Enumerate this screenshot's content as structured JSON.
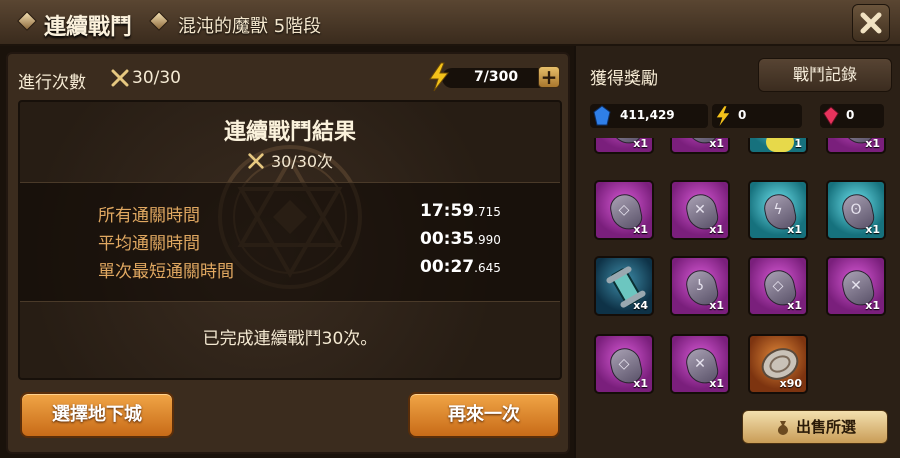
{
  "header": {
    "title": "連續戰鬥",
    "subtitle": "混沌的魔獸 5階段",
    "close_icon": "close-x-icon"
  },
  "left_panel": {
    "run_label": "進行次數",
    "run_count": "30/30",
    "energy": "7/300",
    "energy_plus": "+",
    "result_title": "連續戰鬥結果",
    "result_count": "30/30次",
    "stats": [
      {
        "label": "所有通關時間",
        "value_main": "17:59",
        "value_ms": ".715"
      },
      {
        "label": "平均通關時間",
        "value_main": "00:35",
        "value_ms": ".990"
      },
      {
        "label": "單次最短通關時間",
        "value_main": "00:27",
        "value_ms": ".645"
      }
    ],
    "done_text": "已完成連續戰鬥30次。",
    "btn_select_dungeon": "選擇地下城",
    "btn_retry": "再來一次"
  },
  "right_panel": {
    "rewards_label": "獲得獎勵",
    "log_button": "戰鬥記錄",
    "currencies": [
      {
        "icon": "blue-crystal-icon",
        "value": "411,429",
        "color": "#2f7fe8"
      },
      {
        "icon": "lightning-energy-icon",
        "value": "0",
        "color": "#f4c21a"
      },
      {
        "icon": "red-crystal-icon",
        "value": "0",
        "color": "#e8335c"
      }
    ],
    "items": [
      {
        "type": "purple",
        "glyph": "",
        "qty": "x1"
      },
      {
        "type": "purple",
        "glyph": "",
        "qty": "x1"
      },
      {
        "type": "cyan",
        "glyph": "",
        "qty": "1"
      },
      {
        "type": "purple",
        "glyph": "",
        "qty": "x1"
      },
      {
        "type": "purple",
        "glyph": "◇",
        "qty": "x1"
      },
      {
        "type": "purple",
        "glyph": "✕",
        "qty": "x1"
      },
      {
        "type": "cyan",
        "glyph": "ϟ",
        "qty": "x1"
      },
      {
        "type": "cyan",
        "glyph": "ʘ",
        "qty": "x1"
      },
      {
        "type": "teal",
        "glyph": "",
        "qty": "x4"
      },
      {
        "type": "purple",
        "glyph": "ʖ",
        "qty": "x1"
      },
      {
        "type": "purple",
        "glyph": "◇",
        "qty": "x1"
      },
      {
        "type": "purple",
        "glyph": "✕",
        "qty": "x1"
      },
      {
        "type": "purple",
        "glyph": "◇",
        "qty": "x1"
      },
      {
        "type": "purple",
        "glyph": "✕",
        "qty": "x1"
      },
      {
        "type": "copper",
        "glyph": "",
        "qty": "x90"
      }
    ],
    "sell_button": "出售所選"
  }
}
